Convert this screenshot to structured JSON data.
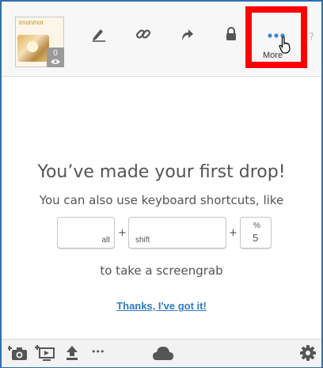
{
  "topbar": {
    "thumbnail_text": "imonmor",
    "view_count": "0",
    "tools": [
      "pen-icon",
      "link-icon",
      "share-arrow-icon",
      "lock-icon"
    ],
    "more_label": "More",
    "help": "?"
  },
  "main": {
    "headline": "You’ve made your first drop!",
    "subline": "You can also use keyboard shortcuts, like",
    "keys": {
      "alt": "alt",
      "shift": "shift",
      "percent_symbol": "%",
      "percent_digit": "5",
      "plus": "+"
    },
    "screengrab": "to take a screengrab",
    "dismiss_link": "Thanks, I've got it!"
  },
  "bottombar": {
    "icons": [
      "camera-plus-icon",
      "screen-record-icon",
      "upload-icon",
      "more-icon",
      "cloud-icon",
      "settings-icon"
    ],
    "more": "•••"
  },
  "colors": {
    "highlight": "#ff0000",
    "link": "#2e7bc4",
    "dots": "#3a86d4",
    "frame": "#2f6fb0"
  }
}
